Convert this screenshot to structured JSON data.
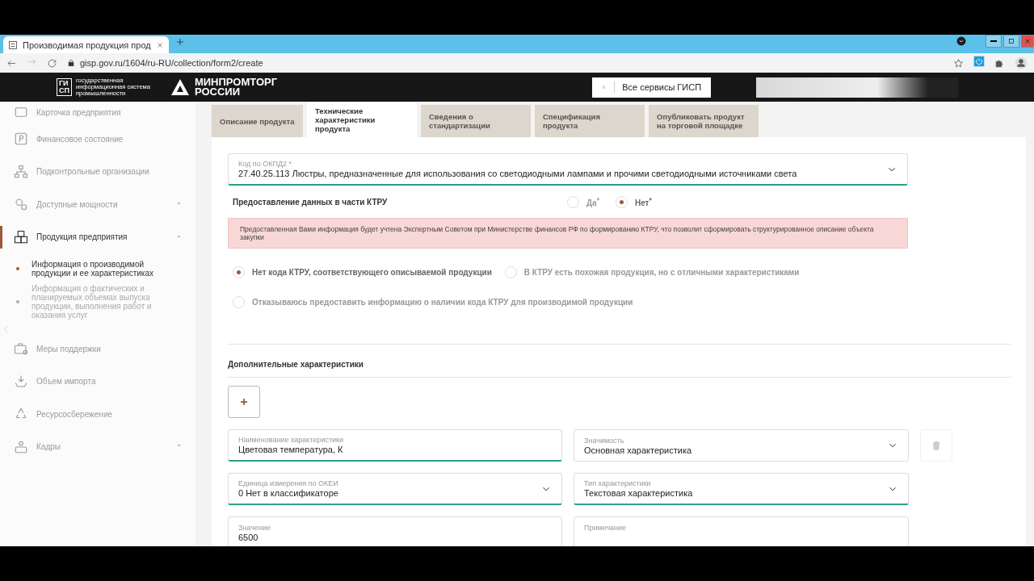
{
  "browser": {
    "tab_title": "Производимая продукция прод",
    "url": "gisp.gov.ru/1604/ru-RU/collection/form2/create"
  },
  "header": {
    "logo_mark": [
      "ГИ",
      "СП"
    ],
    "logo_text": [
      "государственная",
      "информационная система",
      "промышленности"
    ],
    "ministry": [
      "МИНПРОМТОРГ",
      "РОССИИ"
    ],
    "services_button": "Все сервисы ГИСП"
  },
  "sidebar": {
    "items": [
      {
        "label": "Карточка предприятия",
        "selected": false
      },
      {
        "label": "Финансовое состояние",
        "selected": false
      },
      {
        "label": "Подконтрольные организации",
        "selected": false
      },
      {
        "label": "Доступные мощности",
        "selected": false,
        "expanded": false
      },
      {
        "label": "Продукция предприятия",
        "selected": true,
        "expanded": true,
        "children": [
          {
            "label": "Информация о производимой продукции и ее характеристиках",
            "selected": true
          },
          {
            "label": "Информация о фактических и планируемых объемах выпуска продукции, выполнения работ и оказания услуг",
            "selected": false
          }
        ]
      },
      {
        "label": "Меры поддержки",
        "selected": false
      },
      {
        "label": "Объем импорта",
        "selected": false
      },
      {
        "label": "Ресурсосбережение",
        "selected": false
      },
      {
        "label": "Кадры",
        "selected": false,
        "expanded": false
      }
    ]
  },
  "tabs": [
    {
      "label": "Описание продукта",
      "selected": false
    },
    {
      "label": "Технические характеристики продукта",
      "selected": true
    },
    {
      "label": "Сведения о стандартизации",
      "selected": false
    },
    {
      "label": "Спецификация продукта",
      "selected": false
    },
    {
      "label": "Опубликовать продукт на торговой площадке",
      "selected": false
    }
  ],
  "okpd": {
    "label": "Код по ОКПД2 *",
    "value": "27.40.25.113 Люстры, предназначенные для использования со светодиодными лампами и прочими светодиодными источниками света",
    "valid": true
  },
  "ktru": {
    "label": "Предоставление данных в части КТРУ",
    "options": [
      {
        "label": "Да$^{*}$",
        "selected": false
      },
      {
        "label": "Нет$^{*}$",
        "selected": true
      }
    ]
  },
  "notice": "Предоставленная Вами информация будет учтена Экспертным Советом при Министерстве финансов РФ по формированию КТРУ, что позволит сформировать структурированное описание объекта закупки",
  "ktru_options": [
    {
      "label": "Нет кода КТРУ, соответствующего описываемой продукции",
      "selected": true
    },
    {
      "label": "В КТРУ есть похожая продукция, но с отличными характеристиками",
      "selected": false
    },
    {
      "label": "Отказываюсь предоставить информацию о наличии кода КТРУ для производимой продукции",
      "selected": false
    }
  ],
  "additional": {
    "title": "Дополнительные характеристики"
  },
  "fields": [
    {
      "kind": "text",
      "label": "Наименование характеристики",
      "value": "Цветовая температура, К",
      "valid": true
    },
    {
      "kind": "select",
      "label": "Значимость",
      "value": "Основная характеристика",
      "valid": false
    },
    {
      "kind": "select",
      "label": "Единица измерения по ОКЕИ",
      "value": "0 Нет в классификаторе",
      "valid": true
    },
    {
      "kind": "select",
      "label": "Тип характеристики",
      "value": "Текстовая характеристика",
      "valid": true
    },
    {
      "kind": "text",
      "label": "Значение",
      "value": "6500",
      "valid": false
    },
    {
      "kind": "text",
      "label": "Примечание",
      "valid": false
    }
  ]
}
